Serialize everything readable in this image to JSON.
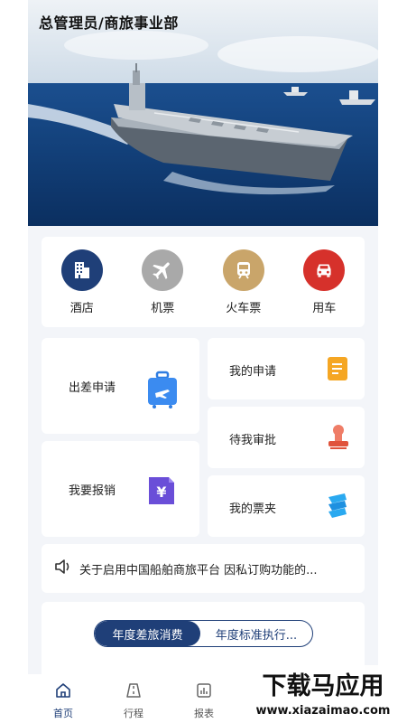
{
  "header": {
    "title": "总管理员/商旅事业部"
  },
  "quick_services": [
    {
      "label": "酒店",
      "icon": "hotel-icon",
      "color": "#1f3f78"
    },
    {
      "label": "机票",
      "icon": "airplane-icon",
      "color": "#a9a9a9"
    },
    {
      "label": "火车票",
      "icon": "train-icon",
      "color": "#c9a56a"
    },
    {
      "label": "用车",
      "icon": "car-icon",
      "color": "#d6312b"
    }
  ],
  "functions": {
    "trip_apply": "出差申请",
    "my_apply": "我的申请",
    "pending_approval": "待我审批",
    "reimburse": "我要报销",
    "ticket_folder": "我的票夹"
  },
  "notice": {
    "text": "关于启用中国船舶商旅平台 因私订购功能的..."
  },
  "stats": {
    "tab_active": "年度差旅消费",
    "tab_inactive": "年度标准执行..."
  },
  "tabbar": [
    {
      "label": "首页",
      "icon": "home-icon",
      "active": true
    },
    {
      "label": "行程",
      "icon": "road-icon",
      "active": false
    },
    {
      "label": "报表",
      "icon": "report-icon",
      "active": false
    }
  ],
  "watermark": {
    "title": "下载马应用",
    "url": "www.xiazaimao.com"
  },
  "colors": {
    "primary": "#1f3f78",
    "background": "#f3f5f9"
  }
}
